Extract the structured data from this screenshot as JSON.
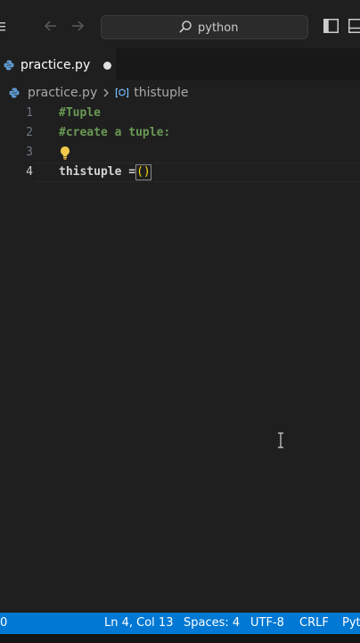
{
  "search": {
    "text": "python"
  },
  "tab": {
    "label": "practice.py"
  },
  "breadcrumb": {
    "file": "practice.py",
    "symbol": "thistuple"
  },
  "editor": {
    "lines": [
      {
        "number": "1",
        "text": "#Tuple"
      },
      {
        "number": "2",
        "text": "#create a tuple:"
      },
      {
        "number": "3",
        "text": ""
      },
      {
        "number": "4",
        "text_ident": "thistuple",
        "text_op": " =",
        "text_paren": "()"
      }
    ]
  },
  "statusbar": {
    "left": "0",
    "position": "Ln 4, Col 13",
    "spaces": "Spaces: 4",
    "encoding": "UTF-8",
    "eol": "CRLF",
    "language": "Pyt"
  },
  "colors": {
    "accent": "#0078d4",
    "comment": "#6a9955",
    "bulb": "#f2c94c"
  }
}
